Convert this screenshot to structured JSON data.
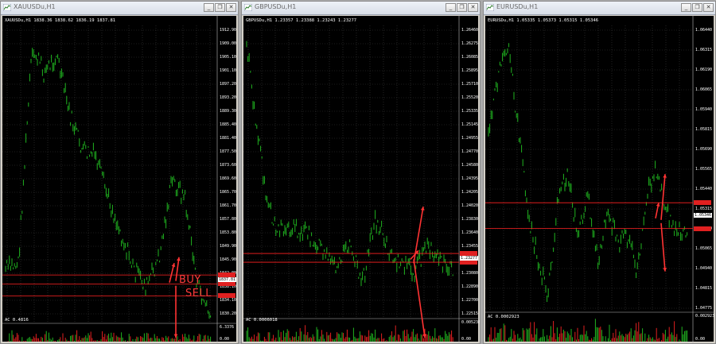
{
  "windows": [
    {
      "id": "xau",
      "title": "XAUUSDu,H1",
      "info": "XAUUSDu,H1  1838.36 1838.62 1836.19 1837.81",
      "prices": [
        1912.9,
        1909.0,
        1905.1,
        1901.1,
        1897.2,
        1893.2,
        1889.3,
        1885.4,
        1881.4,
        1877.5,
        1873.6,
        1869.6,
        1865.7,
        1861.7,
        1857.8,
        1853.8,
        1849.9,
        1845.9,
        1842.0,
        1838.1,
        1834.1,
        1830.2
      ],
      "current_price": "1837.81",
      "line_tags": [
        "",
        "",
        ""
      ],
      "sub_label": "AC 0.4816",
      "sub_ticks": [
        "6.3376",
        "0.00"
      ],
      "annotations": {
        "buy": "BUY",
        "sell": "SELL"
      }
    },
    {
      "id": "gbp",
      "title": "GBPUSDu,H1",
      "info": "GBPUSDu,H1  1.23357 1.23388 1.23243 1.23277",
      "prices": [
        1.2646,
        1.26275,
        1.26085,
        1.25895,
        1.2571,
        1.2552,
        1.25335,
        1.25145,
        1.24955,
        1.2477,
        1.2458,
        1.24395,
        1.24205,
        1.2402,
        1.2383,
        1.2364,
        1.23455,
        1.23265,
        1.2308,
        1.2289,
        1.227,
        1.22515
      ],
      "current_price": "1.23277",
      "line_tags": [
        "",
        ""
      ],
      "sub_label": "AC 0.0006018",
      "sub_ticks": [
        "0.005238",
        "0.00"
      ]
    },
    {
      "id": "eur",
      "title": "EURUSDu,H1",
      "info": "EURUSDu,H1  1.05335 1.05373 1.05315 1.05346",
      "prices": [
        1.0644,
        1.06315,
        1.0619,
        1.06065,
        1.0594,
        1.05815,
        1.0569,
        1.05565,
        1.0544,
        1.05315,
        1.0519,
        1.05065,
        1.0494,
        1.04815
      ],
      "price_ticks": [
        "1.06440",
        "1.06315",
        "1.06190",
        "1.06065",
        "1.05940",
        "1.05815",
        "1.05690",
        "1.05565",
        "1.05440",
        "1.05315",
        "1.05190",
        "1.05065",
        "1.04940",
        "1.04815",
        "1.04775"
      ],
      "current_price": "1.05346",
      "line_tags": [
        "",
        ""
      ],
      "sub_label": "AC 0.0002923",
      "sub_ticks": [
        "0.002923",
        "0.00"
      ]
    }
  ],
  "window_buttons": {
    "minimize": "_",
    "restore": "❐",
    "close": "✕"
  }
}
